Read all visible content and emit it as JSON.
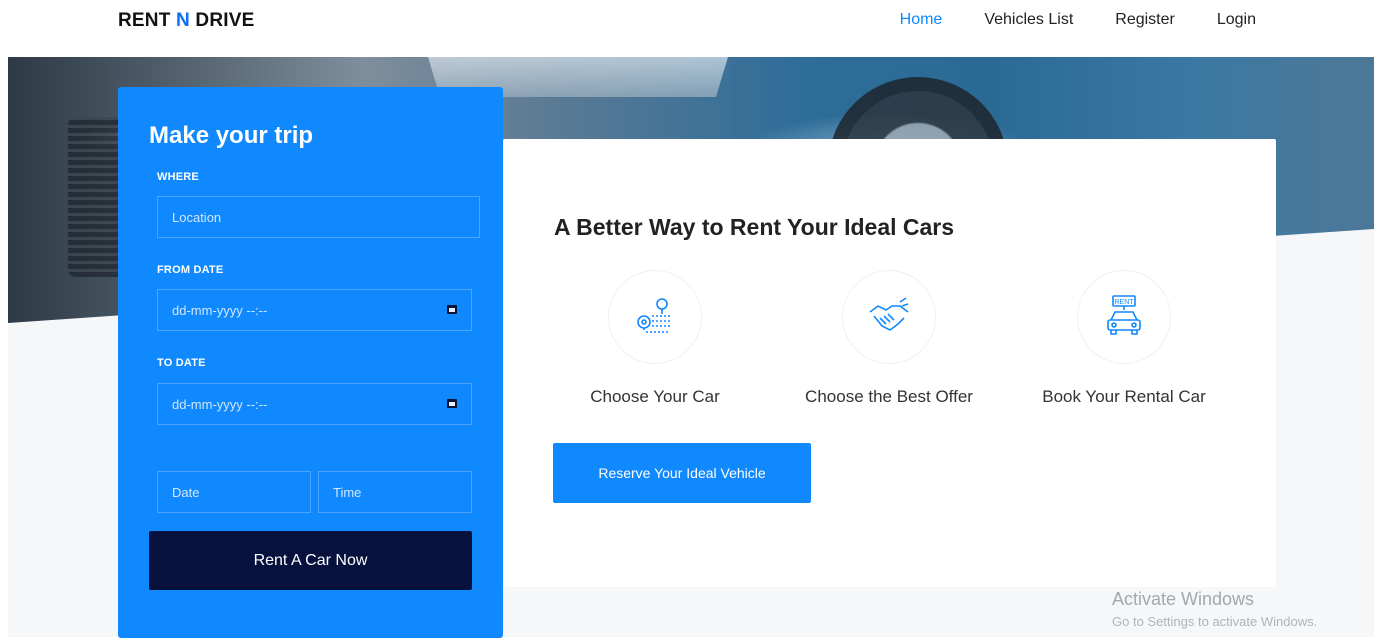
{
  "nav": {
    "brand_part1": "RENT ",
    "brand_accent": "N",
    "brand_part2": " DRIVE",
    "links": [
      "Home",
      "Vehicles List",
      "Register",
      "Login"
    ],
    "active_link": "Home"
  },
  "booking_form": {
    "title": "Make your trip",
    "where_label": "WHERE",
    "location_placeholder": "Location",
    "from_label": "FROM DATE",
    "from_placeholder": "dd-mm-yyyy --:--",
    "to_label": "TO DATE",
    "to_placeholder": "dd-mm-yyyy --:--",
    "date_placeholder": "Date",
    "time_placeholder": "Time",
    "submit_label": "Rent A Car Now"
  },
  "info": {
    "title": "A Better Way to Rent Your Ideal Cars",
    "services": [
      {
        "label": "Choose Your Car",
        "icon": "route-pin-icon"
      },
      {
        "label": "Choose the Best Offer",
        "icon": "handshake-icon"
      },
      {
        "label": "Book Your Rental Car",
        "icon": "rent-car-icon"
      }
    ],
    "cta_label": "Reserve Your Ideal Vehicle",
    "rent_sign_text": "RENT"
  },
  "watermark": {
    "title": "Activate Windows",
    "subtitle": "Go to Settings to activate Windows."
  },
  "colors": {
    "primary": "#1089ff",
    "dark_button": "#06123d",
    "brand_accent": "#0d6efd"
  }
}
